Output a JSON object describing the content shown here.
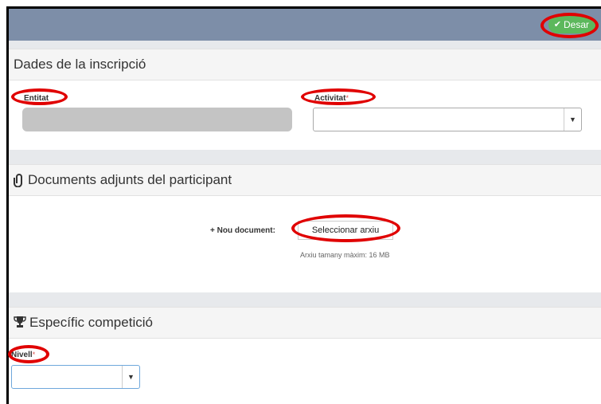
{
  "toolbar": {
    "save_label": "Desar"
  },
  "section_registration": {
    "title": "Dades de la inscripció",
    "entity_label": "Entitat",
    "activity_label": "Activitat",
    "activity_required_mark": "*",
    "activity_value": ""
  },
  "section_documents": {
    "title": "Documents adjunts del participant",
    "new_document_label": "+ Nou document:",
    "select_file_label": "Seleccionar arxiu",
    "max_size_hint": "Arxiu tamany màxim: 16 MB"
  },
  "section_competition": {
    "title": "Específic competició",
    "level_label": "Nivell",
    "level_required_mark": "*",
    "level_value": ""
  },
  "icons": {
    "save": "check-icon",
    "documents": "paperclip-icon",
    "competition": "trophy-icon",
    "dropdown": "caret-down-icon"
  },
  "colors": {
    "topbar": "#7d8ea8",
    "save_button": "#5cb85c",
    "highlight": "#e00000",
    "readonly_field": "#c4c4c4"
  }
}
